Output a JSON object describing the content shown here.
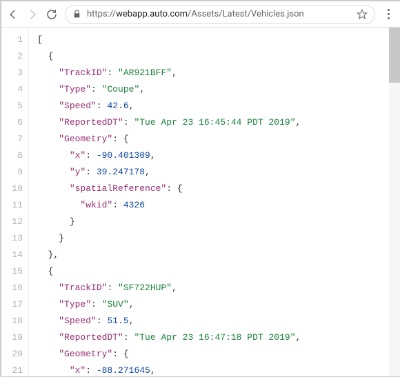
{
  "url_scheme": "https://",
  "url_host": "webapp.auto.com",
  "url_path": "/Assets/Latest/Vehicles.json",
  "lines": [
    {
      "n": "1",
      "indent": 0,
      "tokens": [
        {
          "t": "punct",
          "v": "["
        }
      ]
    },
    {
      "n": "2",
      "indent": 1,
      "tokens": [
        {
          "t": "punct",
          "v": "{"
        }
      ]
    },
    {
      "n": "3",
      "indent": 2,
      "tokens": [
        {
          "t": "key",
          "v": "\"TrackID\""
        },
        {
          "t": "punct",
          "v": ": "
        },
        {
          "t": "str",
          "v": "\"AR921BFF\""
        },
        {
          "t": "punct",
          "v": ","
        }
      ]
    },
    {
      "n": "4",
      "indent": 2,
      "tokens": [
        {
          "t": "key",
          "v": "\"Type\""
        },
        {
          "t": "punct",
          "v": ": "
        },
        {
          "t": "str",
          "v": "\"Coupe\""
        },
        {
          "t": "punct",
          "v": ","
        }
      ]
    },
    {
      "n": "5",
      "indent": 2,
      "tokens": [
        {
          "t": "key",
          "v": "\"Speed\""
        },
        {
          "t": "punct",
          "v": ": "
        },
        {
          "t": "num",
          "v": "42.6"
        },
        {
          "t": "punct",
          "v": ","
        }
      ]
    },
    {
      "n": "6",
      "indent": 2,
      "tokens": [
        {
          "t": "key",
          "v": "\"ReportedDT\""
        },
        {
          "t": "punct",
          "v": ": "
        },
        {
          "t": "str",
          "v": "\"Tue Apr 23 16:45:44 PDT 2019\""
        },
        {
          "t": "punct",
          "v": ","
        }
      ]
    },
    {
      "n": "7",
      "indent": 2,
      "tokens": [
        {
          "t": "key",
          "v": "\"Geometry\""
        },
        {
          "t": "punct",
          "v": ": {"
        }
      ]
    },
    {
      "n": "8",
      "indent": 3,
      "tokens": [
        {
          "t": "key",
          "v": "\"x\""
        },
        {
          "t": "punct",
          "v": ": "
        },
        {
          "t": "num",
          "v": "-90.401309"
        },
        {
          "t": "punct",
          "v": ","
        }
      ]
    },
    {
      "n": "9",
      "indent": 3,
      "tokens": [
        {
          "t": "key",
          "v": "\"y\""
        },
        {
          "t": "punct",
          "v": ": "
        },
        {
          "t": "num",
          "v": "39.247178"
        },
        {
          "t": "punct",
          "v": ","
        }
      ]
    },
    {
      "n": "10",
      "indent": 3,
      "tokens": [
        {
          "t": "key",
          "v": "\"spatialReference\""
        },
        {
          "t": "punct",
          "v": ": {"
        }
      ]
    },
    {
      "n": "11",
      "indent": 4,
      "tokens": [
        {
          "t": "key",
          "v": "\"wkid\""
        },
        {
          "t": "punct",
          "v": ": "
        },
        {
          "t": "num",
          "v": "4326"
        }
      ]
    },
    {
      "n": "12",
      "indent": 3,
      "tokens": [
        {
          "t": "punct",
          "v": "}"
        }
      ]
    },
    {
      "n": "13",
      "indent": 2,
      "tokens": [
        {
          "t": "punct",
          "v": "}"
        }
      ]
    },
    {
      "n": "14",
      "indent": 1,
      "tokens": [
        {
          "t": "punct",
          "v": "},"
        }
      ]
    },
    {
      "n": "15",
      "indent": 1,
      "tokens": [
        {
          "t": "punct",
          "v": "{"
        }
      ]
    },
    {
      "n": "16",
      "indent": 2,
      "tokens": [
        {
          "t": "key",
          "v": "\"TrackID\""
        },
        {
          "t": "punct",
          "v": ": "
        },
        {
          "t": "str",
          "v": "\"SF722HUP\""
        },
        {
          "t": "punct",
          "v": ","
        }
      ]
    },
    {
      "n": "17",
      "indent": 2,
      "tokens": [
        {
          "t": "key",
          "v": "\"Type\""
        },
        {
          "t": "punct",
          "v": ": "
        },
        {
          "t": "str",
          "v": "\"SUV\""
        },
        {
          "t": "punct",
          "v": ","
        }
      ]
    },
    {
      "n": "18",
      "indent": 2,
      "tokens": [
        {
          "t": "key",
          "v": "\"Speed\""
        },
        {
          "t": "punct",
          "v": ": "
        },
        {
          "t": "num",
          "v": "51.5"
        },
        {
          "t": "punct",
          "v": ","
        }
      ]
    },
    {
      "n": "19",
      "indent": 2,
      "tokens": [
        {
          "t": "key",
          "v": "\"ReportedDT\""
        },
        {
          "t": "punct",
          "v": ": "
        },
        {
          "t": "str",
          "v": "\"Tue Apr 23 16:47:18 PDT 2019\""
        },
        {
          "t": "punct",
          "v": ","
        }
      ]
    },
    {
      "n": "20",
      "indent": 2,
      "tokens": [
        {
          "t": "key",
          "v": "\"Geometry\""
        },
        {
          "t": "punct",
          "v": ": {"
        }
      ]
    },
    {
      "n": "21",
      "indent": 3,
      "tokens": [
        {
          "t": "key",
          "v": "\"x\""
        },
        {
          "t": "punct",
          "v": ": "
        },
        {
          "t": "num",
          "v": "-88.271645"
        },
        {
          "t": "punct",
          "v": ","
        }
      ]
    }
  ]
}
